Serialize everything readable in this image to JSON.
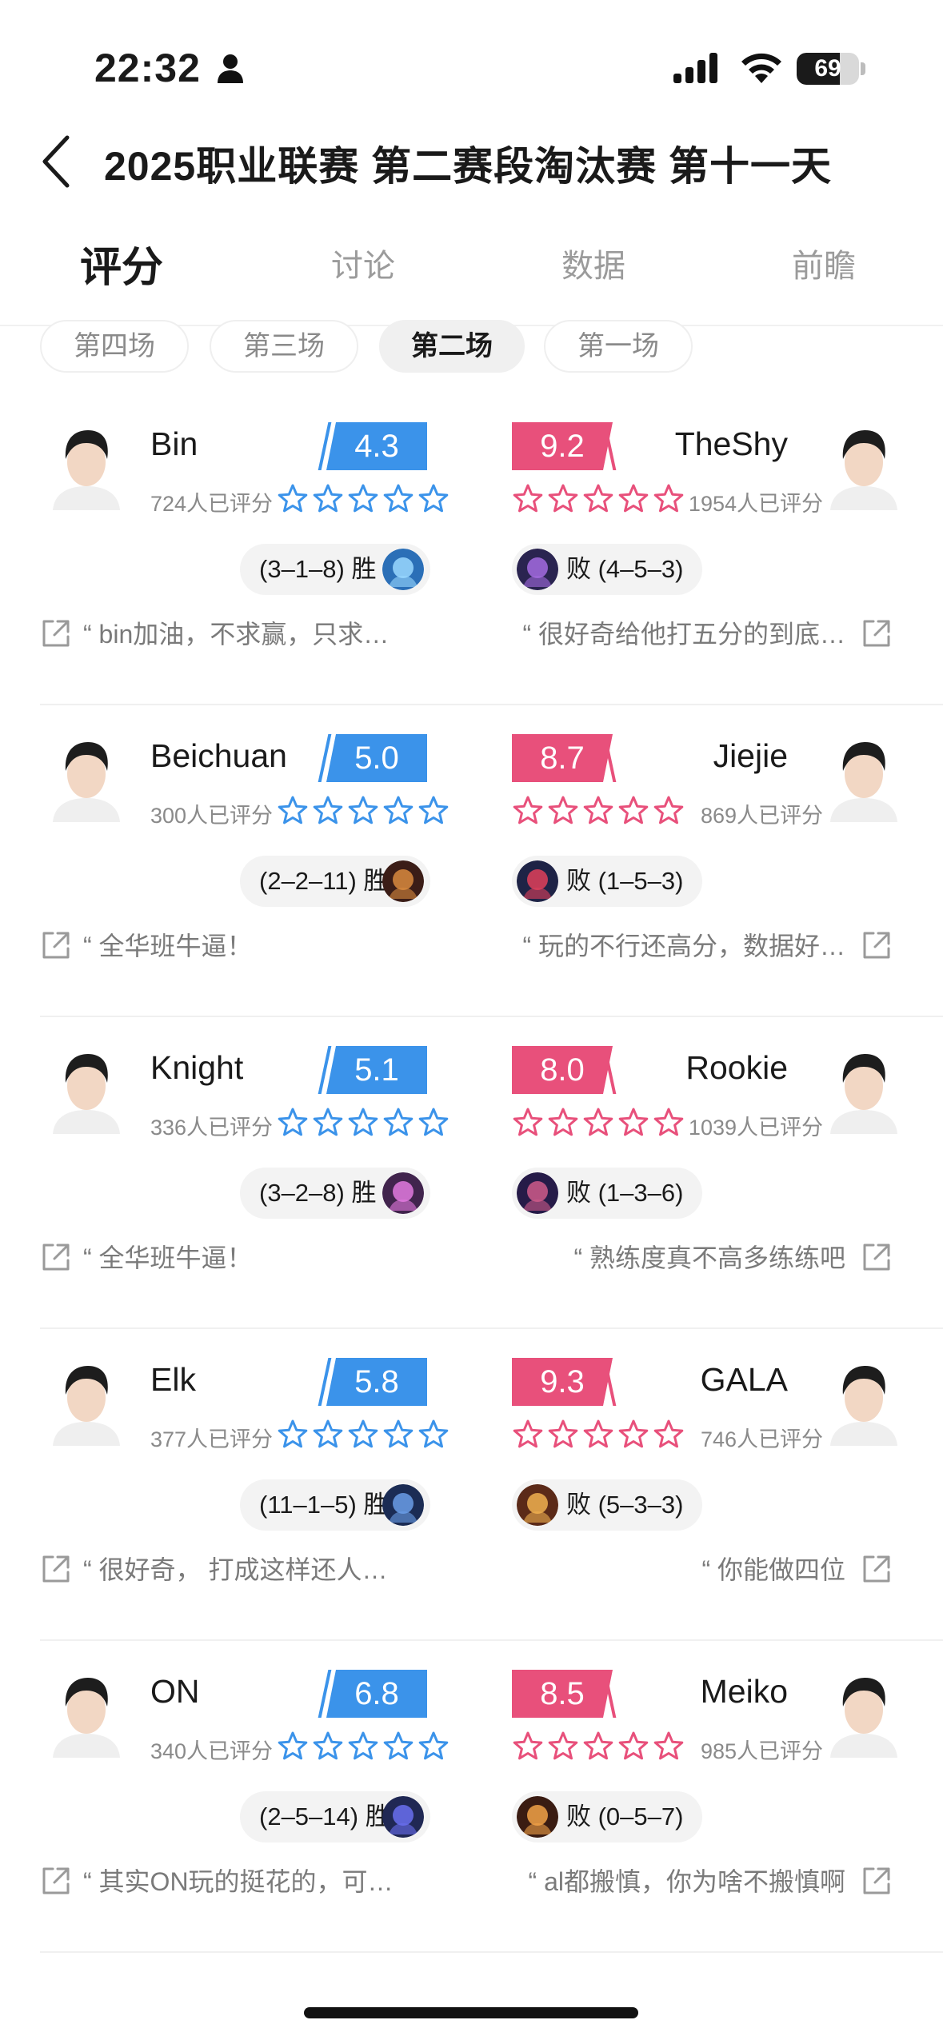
{
  "status": {
    "time": "22:32",
    "battery": 69
  },
  "nav": {
    "title": "2025职业联赛 第二赛段淘汰赛 第十一天"
  },
  "tabs": [
    "评分",
    "讨论",
    "数据",
    "前瞻"
  ],
  "chips": [
    "第四场",
    "第三场",
    "第二场",
    "第一场"
  ],
  "active_chip_index": 2,
  "colors": {
    "blue": "#3b93ea",
    "pink": "#e8507b"
  },
  "matchups": [
    {
      "left": {
        "name": "Bin",
        "score": "4.3",
        "count": "724人已评分",
        "result": "(3–1–8) 胜",
        "comment": "“ bin加油，不求赢，只求…",
        "champ_icon": "champion-portrait-icon"
      },
      "right": {
        "name": "TheShy",
        "score": "9.2",
        "count": "1954人已评分",
        "result": "败 (4–5–3)",
        "comment": "“ 很好奇给他打五分的到底…",
        "champ_icon": "champion-portrait-icon"
      }
    },
    {
      "left": {
        "name": "Beichuan",
        "score": "5.0",
        "count": "300人已评分",
        "result": "(2–2–11) 胜",
        "comment": "“ 全华班牛逼！",
        "champ_icon": "champion-portrait-icon"
      },
      "right": {
        "name": "Jiejie",
        "score": "8.7",
        "count": "869人已评分",
        "result": "败 (1–5–3)",
        "comment": "“ 玩的不行还高分，数据好…",
        "champ_icon": "champion-portrait-icon"
      }
    },
    {
      "left": {
        "name": "Knight",
        "score": "5.1",
        "count": "336人已评分",
        "result": "(3–2–8) 胜",
        "comment": "“ 全华班牛逼！",
        "champ_icon": "champion-portrait-icon"
      },
      "right": {
        "name": "Rookie",
        "score": "8.0",
        "count": "1039人已评分",
        "result": "败 (1–3–6)",
        "comment": "“ 熟练度真不高多练练吧",
        "champ_icon": "champion-portrait-icon"
      }
    },
    {
      "left": {
        "name": "Elk",
        "score": "5.8",
        "count": "377人已评分",
        "result": "(11–1–5) 胜",
        "comment": "“ 很好奇， 打成这样还人…",
        "champ_icon": "champion-portrait-icon"
      },
      "right": {
        "name": "GALA",
        "score": "9.3",
        "count": "746人已评分",
        "result": "败 (5–3–3)",
        "comment": "“ 你能做四位",
        "champ_icon": "champion-portrait-icon"
      }
    },
    {
      "left": {
        "name": "ON",
        "score": "6.8",
        "count": "340人已评分",
        "result": "(2–5–14) 胜",
        "comment": "“ 其实ON玩的挺花的，可…",
        "champ_icon": "champion-portrait-icon"
      },
      "right": {
        "name": "Meiko",
        "score": "8.5",
        "count": "985人已评分",
        "result": "败 (0–5–7)",
        "comment": "“ al都搬慎，你为啥不搬慎啊",
        "champ_icon": "champion-portrait-icon"
      }
    }
  ]
}
